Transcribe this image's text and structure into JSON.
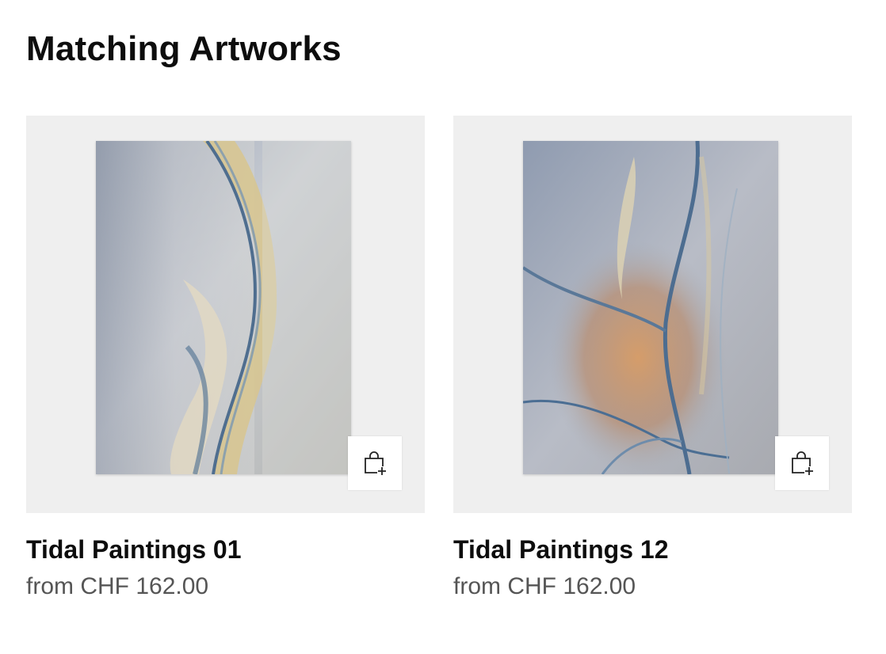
{
  "section": {
    "title": "Matching Artworks"
  },
  "artworks": [
    {
      "title": "Tidal Paintings 01",
      "price": "from CHF 162.00"
    },
    {
      "title": "Tidal Paintings 12",
      "price": "from CHF 162.00"
    }
  ],
  "icons": {
    "add_to_cart": "shopping-bag-plus-icon"
  },
  "colors": {
    "background": "#ffffff",
    "card_background": "#efefef",
    "title": "#0d0d0d",
    "price": "#555555"
  }
}
